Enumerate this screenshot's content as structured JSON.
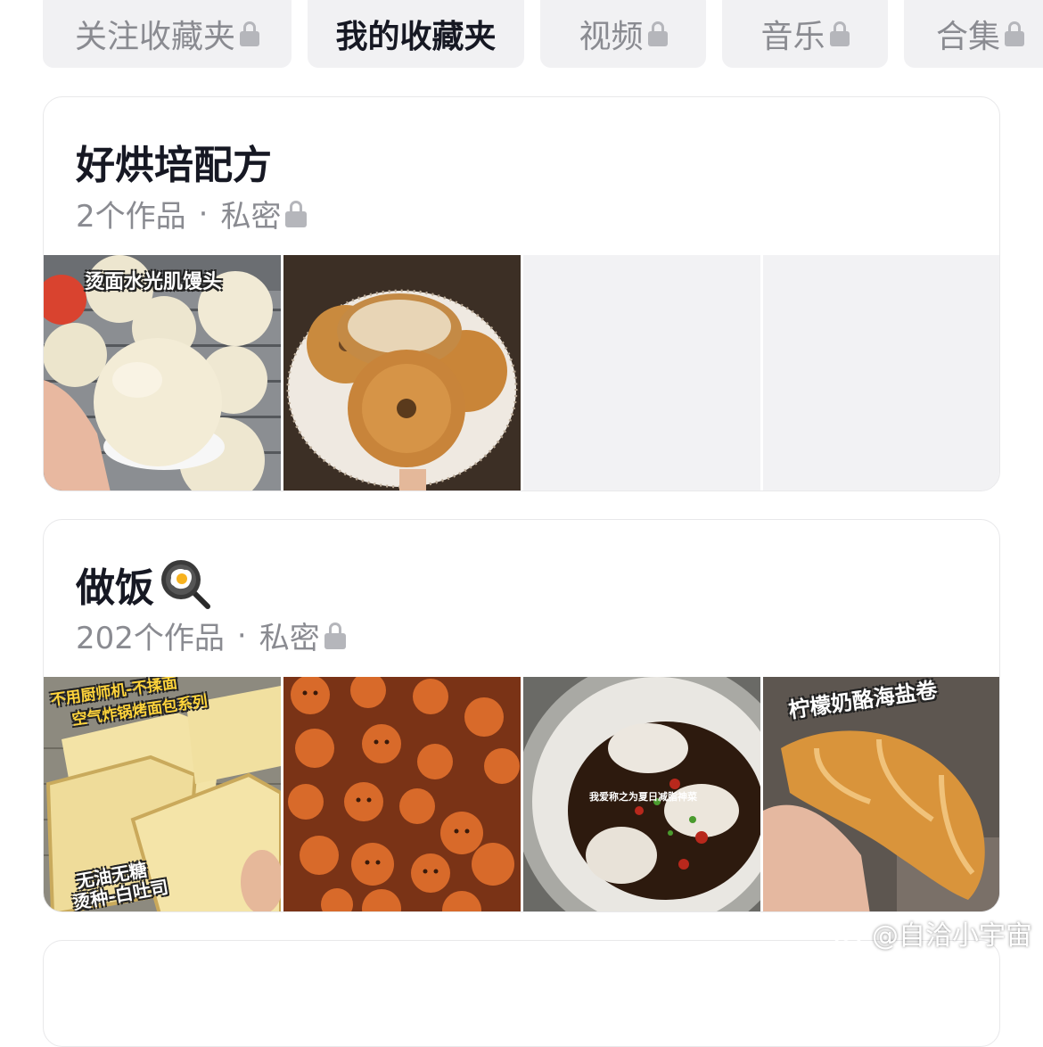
{
  "tabs": [
    {
      "label": "关注收藏夹",
      "locked": true,
      "active": false
    },
    {
      "label": "我的收藏夹",
      "locked": false,
      "active": true
    },
    {
      "label": "视频",
      "locked": true,
      "active": false
    },
    {
      "label": "音乐",
      "locked": true,
      "active": false
    },
    {
      "label": "合集",
      "locked": true,
      "active": false
    }
  ],
  "collections": [
    {
      "title": "好烘培配方",
      "count": "2个作品",
      "separator": "·",
      "privacy": "私密",
      "thumbs": [
        {
          "caption": "烫面水光肌馒头"
        },
        {
          "caption": ""
        },
        {
          "caption": ""
        },
        {
          "caption": ""
        }
      ]
    },
    {
      "title": "做饭",
      "count": "202个作品",
      "separator": "·",
      "privacy": "私密",
      "thumbs": [
        {
          "caption": "不用厨师机-不揉面",
          "caption2": "空气炸锅烤面包系列",
          "caption3": "无油无糖",
          "caption4": "烫种-白吐司"
        },
        {
          "caption": ""
        },
        {
          "caption": "我爱称之为夏日减脂神菜"
        },
        {
          "caption": "柠檬奶酪海盐卷"
        }
      ]
    }
  ],
  "watermark": "@自洽小宇宙",
  "colors": {
    "tab_bg": "#f1f1f3",
    "muted_text": "#8a8b91",
    "primary_text": "#161823",
    "lock": "#b5b6bb"
  }
}
